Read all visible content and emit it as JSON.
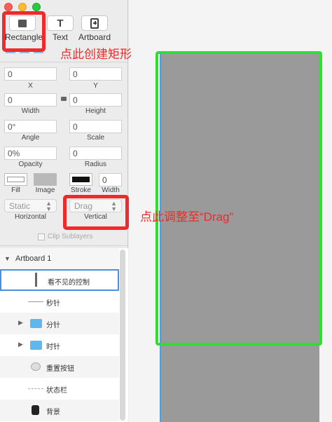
{
  "toolbar": {
    "tools": [
      {
        "label": "Rectangle",
        "icon": "rectangle-icon"
      },
      {
        "label": "Text",
        "icon": "text-tool-icon"
      },
      {
        "label": "Artboard",
        "icon": "artboard-icon"
      }
    ]
  },
  "inspector": {
    "x": {
      "value": "0",
      "label": "X"
    },
    "y": {
      "value": "0",
      "label": "Y"
    },
    "width": {
      "value": "0",
      "label": "Width"
    },
    "height": {
      "value": "0",
      "label": "Height"
    },
    "angle": {
      "value": "0°",
      "label": "Angle"
    },
    "scale": {
      "value": "0",
      "label": "Scale"
    },
    "opacity": {
      "value": "0%",
      "label": "Opacity"
    },
    "radius": {
      "value": "0",
      "label": "Radius"
    },
    "fill_label": "Fill",
    "image_label": "Image",
    "stroke_label": "Stroke",
    "stroke_width": {
      "value": "0",
      "label": "Width"
    },
    "horizontal": {
      "value": "Static",
      "label": "Horizontal"
    },
    "vertical": {
      "value": "Drag",
      "label": "Vertical"
    },
    "clip_label": "Clip Sublayers"
  },
  "layers": {
    "artboard_title": "Artboard 1",
    "items": [
      {
        "label": "看不见的控制",
        "icon": "rectangle-layer-icon"
      },
      {
        "label": "秒针",
        "icon": "line-layer-icon"
      },
      {
        "label": "分针",
        "icon": "folder-icon"
      },
      {
        "label": "时针",
        "icon": "folder-icon"
      },
      {
        "label": "重置按钮",
        "icon": "button-layer-icon"
      },
      {
        "label": "状态栏",
        "icon": "line-layer-icon"
      },
      {
        "label": "背景",
        "icon": "background-layer-icon"
      }
    ]
  },
  "annotations": {
    "rect_hint": "点此创建矩形",
    "drag_hint": "点此调整至“Drag”"
  },
  "colors": {
    "annotation_red": "#ee2a2a",
    "highlight_green": "#2ee02e",
    "artboard_gray": "#9a9a9a",
    "selection_blue": "#4a90e2"
  }
}
